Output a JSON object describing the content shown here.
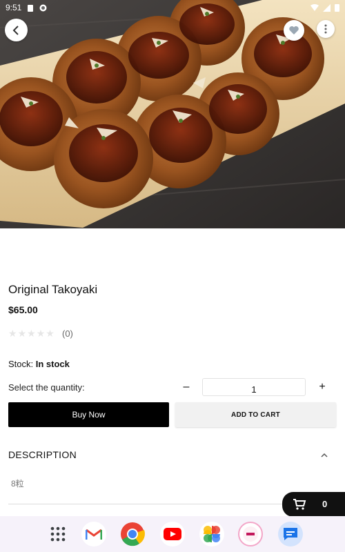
{
  "status_bar": {
    "time": "9:51"
  },
  "product": {
    "title": "Original Takoyaki",
    "price": "$65.00",
    "rating_count": "(0)",
    "rating_value": 0,
    "stock_label": "Stock:",
    "stock_value": "In stock",
    "quantity_label": "Select the quantity:",
    "quantity_value": "1",
    "quantity_minus": "–",
    "quantity_plus": "+"
  },
  "actions": {
    "buy_now": "Buy Now",
    "add_to_cart": "ADD TO CART"
  },
  "description": {
    "header": "DESCRIPTION",
    "text": "8粒"
  },
  "cart": {
    "count": "0"
  },
  "dock": {
    "apps": [
      "app-drawer-icon",
      "gmail-icon",
      "chrome-icon",
      "youtube-icon",
      "photos-icon",
      "store-app-icon",
      "messages-icon"
    ]
  }
}
